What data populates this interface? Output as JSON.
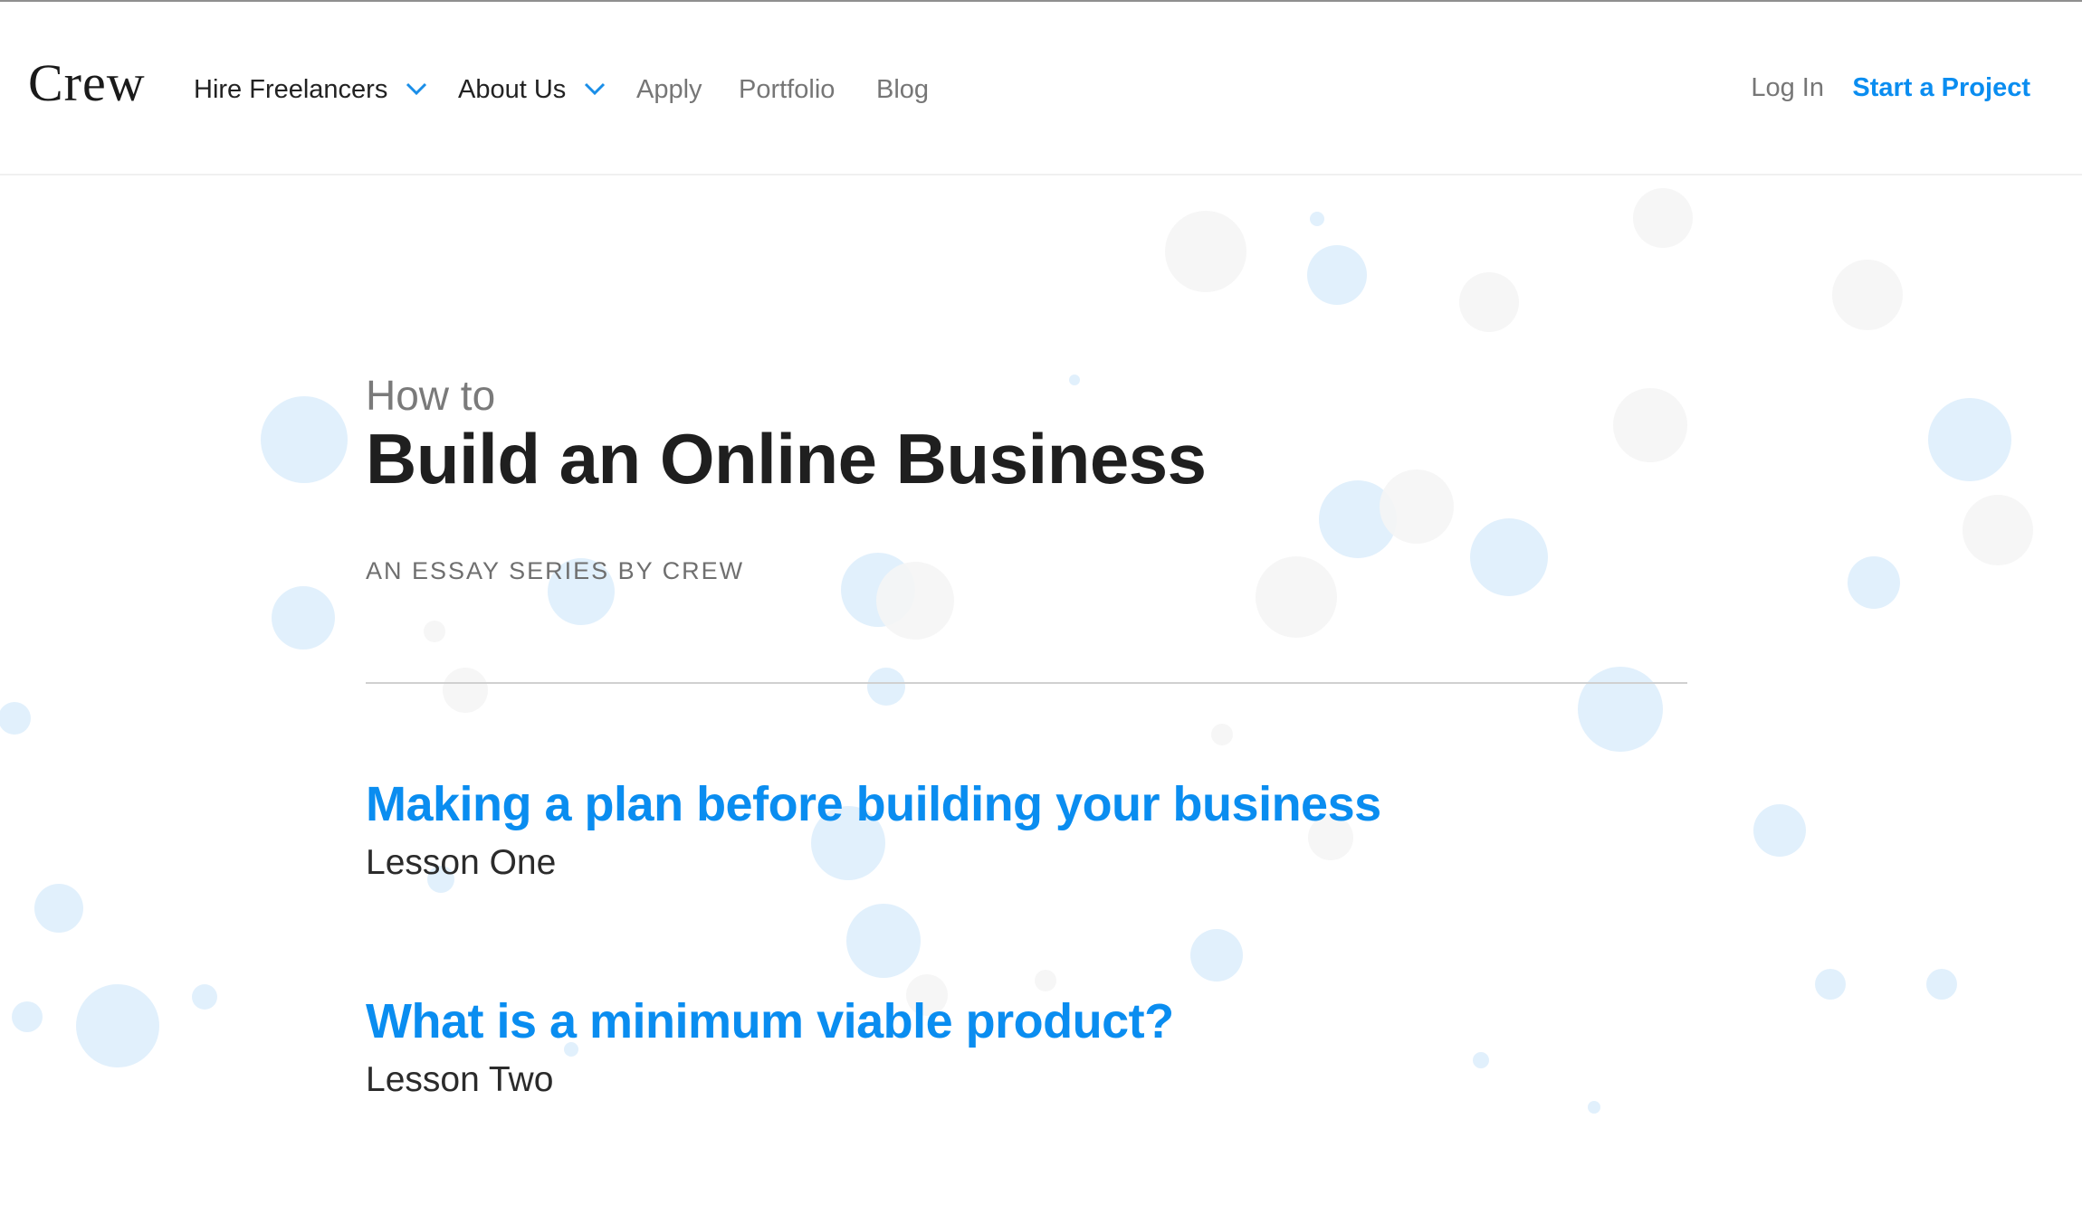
{
  "header": {
    "logo": "Crew",
    "nav": [
      {
        "label": "Hire Freelancers",
        "has_dropdown": true
      },
      {
        "label": "About Us",
        "has_dropdown": true
      },
      {
        "label": "Apply",
        "has_dropdown": false
      },
      {
        "label": "Portfolio",
        "has_dropdown": false
      },
      {
        "label": "Blog",
        "has_dropdown": false
      }
    ],
    "login": "Log In",
    "cta": "Start a Project"
  },
  "hero": {
    "eyebrow": "How to",
    "title": "Build an Online Business",
    "series": "AN ESSAY SERIES BY CREW"
  },
  "lessons": [
    {
      "title": "Making a plan before building your business",
      "subtitle": "Lesson One"
    },
    {
      "title": "What is a minimum viable product?",
      "subtitle": "Lesson Two"
    }
  ],
  "colors": {
    "accent": "#0a8df0",
    "bubble_blue": "#dcedfc",
    "bubble_grey": "#f5f5f5",
    "chevron": "#1a8ee8"
  },
  "icons": {
    "dropdown": "chevron-down-icon"
  }
}
